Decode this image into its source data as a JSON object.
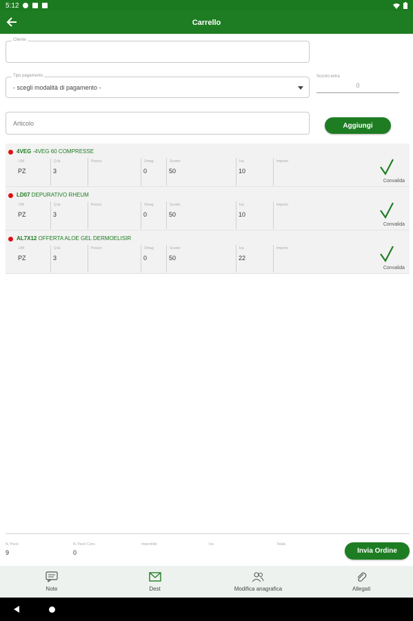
{
  "status_bar": {
    "time": "5:12"
  },
  "header": {
    "title": "Carrello"
  },
  "form": {
    "cliente_label": "Cliente",
    "pagamento_label": "Tipo pagamento",
    "pagamento_value": "- scegli modalità di pagamento -",
    "sconto_label": "Sconto extra",
    "sconto_value": "0",
    "articolo_placeholder": "Articolo",
    "aggiungi_label": "Aggiungi"
  },
  "columns": {
    "um": "UM",
    "qta": "Q.tà",
    "prezzo": "Prezzo",
    "omag": "Omag",
    "sconto": "Sconto",
    "iva": "Iva",
    "importo": "Importo"
  },
  "items": [
    {
      "code": "4VEG",
      "description": "-4VEG 60 COMPRESSE",
      "um": "PZ",
      "qta": "3",
      "prezzo": "",
      "omag": "0",
      "sconto": "50",
      "iva": "10",
      "importo": "",
      "action": "Convalida"
    },
    {
      "code": "LD07",
      "description": "DEPURATIVO RHEUM",
      "um": "PZ",
      "qta": "3",
      "prezzo": "",
      "omag": "0",
      "sconto": "50",
      "iva": "10",
      "importo": "",
      "action": "Convalida"
    },
    {
      "code": "AL7X12",
      "description": "OFFERTA ALOE GEL DERMOELISIR",
      "um": "PZ",
      "qta": "3",
      "prezzo": "",
      "omag": "0",
      "sconto": "50",
      "iva": "22",
      "importo": "",
      "action": "Convalida"
    }
  ],
  "totals": {
    "n_pezzi_label": "N. Pezzi",
    "n_pezzi": "9",
    "n_pezzi_conv_label": "N. Pezzi Conv.",
    "n_pezzi_conv": "0",
    "imponibile_label": "Imponibile",
    "iva_label": "Iva",
    "totale_label": "Totale",
    "invia_label": "Invia Ordine"
  },
  "bottom_nav": [
    {
      "label": "Note",
      "icon": "chat-icon"
    },
    {
      "label": "Dest",
      "icon": "mail-icon"
    },
    {
      "label": "Modifica anagrafica",
      "icon": "users-icon"
    },
    {
      "label": "Allegati",
      "icon": "paperclip-icon"
    }
  ],
  "colors": {
    "primary": "#1e7d22",
    "dot": "#e01010",
    "list_bg": "#f2f2f2"
  }
}
